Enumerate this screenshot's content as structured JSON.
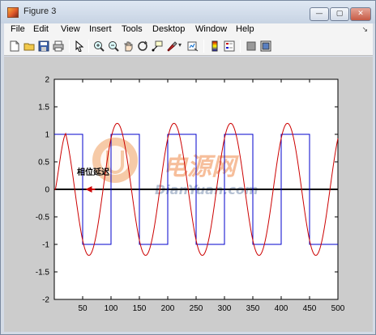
{
  "window": {
    "title": "Figure 3",
    "minimize_label": "—",
    "maximize_label": "▢",
    "close_label": "✕"
  },
  "menu": {
    "items": [
      "File",
      "Edit",
      "View",
      "Insert",
      "Tools",
      "Desktop",
      "Window",
      "Help"
    ],
    "overflow_glyph": "↘"
  },
  "toolbar": {
    "icons": [
      "new-figure-icon",
      "open-file-icon",
      "save-icon",
      "print-icon",
      "pointer-icon",
      "zoom-in-icon",
      "zoom-out-icon",
      "pan-icon",
      "rotate-3d-icon",
      "data-cursor-icon",
      "brush-icon",
      "link-plot-icon",
      "colorbar-icon",
      "legend-icon",
      "hide-plot-tools-icon",
      "show-plot-tools-icon"
    ]
  },
  "watermark": {
    "cn_text": "电源网",
    "en_text": "DianYuan.com"
  },
  "annotation": {
    "text": "相位延迟"
  },
  "chart_data": {
    "type": "line",
    "xlim": [
      0,
      500
    ],
    "ylim": [
      -2,
      2
    ],
    "xticks": [
      50,
      100,
      150,
      200,
      250,
      300,
      350,
      400,
      450,
      500
    ],
    "yticks": [
      -2,
      -1.5,
      -1,
      -0.5,
      0,
      0.5,
      1,
      1.5,
      2
    ],
    "ytick_labels": [
      "-2",
      "-1.5",
      "-1",
      "-0.5",
      "0",
      "0.5",
      "1",
      "1.5",
      "2"
    ],
    "grid": false,
    "series": [
      {
        "color": "#0000cc",
        "kind": "square",
        "x": [
          0,
          50,
          50,
          100,
          100,
          150,
          150,
          200,
          200,
          250,
          250,
          300,
          300,
          350,
          350,
          400,
          400,
          450,
          450,
          500
        ],
        "y": [
          1,
          1,
          -1,
          -1,
          1,
          1,
          -1,
          -1,
          1,
          1,
          -1,
          -1,
          1,
          1,
          -1,
          -1,
          1,
          1,
          -1,
          -1
        ]
      },
      {
        "color": "#cc0000",
        "kind": "lagged-sine",
        "amplitude": 1.2,
        "period": 50,
        "lag": 11
      }
    ],
    "zero_line_color": "#000000"
  }
}
